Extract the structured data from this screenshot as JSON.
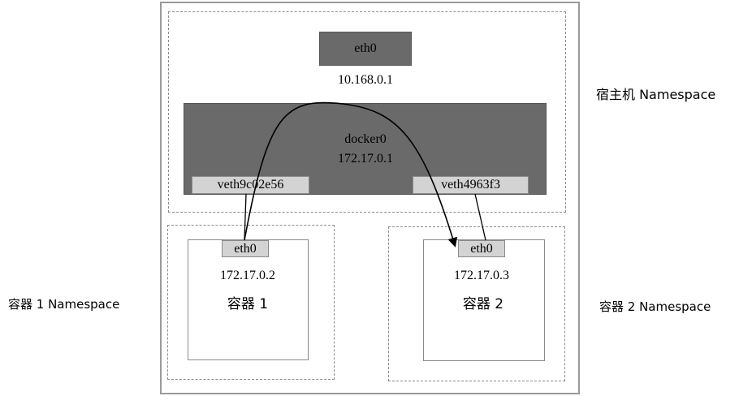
{
  "host": {
    "namespace_label": "宿主机 Namespace",
    "eth0_label": "eth0",
    "eth0_ip": "10.168.0.1",
    "bridge_name": "docker0",
    "bridge_ip": "172.17.0.1",
    "veth1_label": "veth9c02e56",
    "veth2_label": "veth4963f3"
  },
  "container1": {
    "namespace_label": "容器 1 Namespace",
    "eth0_label": "eth0",
    "ip": "172.17.0.2",
    "name": "容器 1"
  },
  "container2": {
    "namespace_label": "容器 2 Namespace",
    "eth0_label": "eth0",
    "ip": "172.17.0.3",
    "name": "容器 2"
  },
  "colors": {
    "dark_box": "#6a6a6a",
    "light_box": "#d3d3d3",
    "border": "#8a8a8a"
  }
}
